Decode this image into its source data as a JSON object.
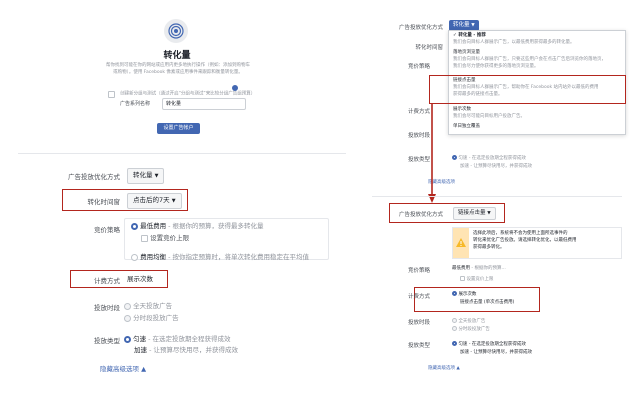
{
  "left": {
    "header": {
      "title": "转化量",
      "desc1": "帮你找到可能在你的网站或应用内更多地执行操作（例如：添加到购物车",
      "desc2": "或购物）。使用 Facebook 像素或应用事件来跟踪和衡量转化量。",
      "checkbox_label": "创建新分组与测试（通过开启“分组与测试”来比较分组广告组预算）",
      "campaign_name_label": "广告系列名称",
      "campaign_name_value": "转化量",
      "set_account_button": "设置广告帐户"
    },
    "optimization": {
      "label": "广告投放优化方式",
      "value": "转化量"
    },
    "window": {
      "label": "转化时间窗",
      "value": "点击后的7天"
    },
    "bid": {
      "label": "竞价策略",
      "option1_title": "最低费用",
      "option1_desc": " - 根据你的预算，获得最多转化量",
      "cap_label": "设置竞价上限",
      "option2_title": "费用均衡",
      "option2_desc": " - 按你指定预算时，将单次转化费用稳定在平均值"
    },
    "billing": {
      "label": "计费方式",
      "value": "展示次数"
    },
    "schedule": {
      "label": "投放时段",
      "option1": "全天投放广告",
      "option2": "分时段投放广告"
    },
    "delivery": {
      "label": "投放类型",
      "option1_title": "匀速",
      "option1_desc": " - 在选定投放期全程获得成效",
      "option2_title": "加速",
      "option2_desc": " - 让预算尽快用尽，并获得成效"
    },
    "hide_link": "隐藏高级选项 ▲"
  },
  "right": {
    "top": {
      "opt_label": "广告投放优化方式",
      "opt_value": "转化量",
      "window_label": "转化时间窗",
      "bid_label": "竞价策略",
      "billing_label": "计费方式",
      "schedule_label": "投放时段",
      "delivery_label": "投放类型",
      "delivery_desc": "匀速 - 在选定投放期全程获得成效",
      "delivery_desc2": "加速 - 让预算尽快用尽，并获得成效",
      "hide_link": "隐藏高级选项"
    },
    "menu": {
      "item1": "✓ 转化量 - 推荐",
      "item1_desc1": "我们会向目标人群展示广告，以最低费用获得最多的转化量。",
      "item2": "落地页浏览量",
      "item2_desc1": "我们会向目标人群展示广告，只要这些用户会在点击广告后浏览你的落地页，",
      "item2_desc2": "我们会尽力使你获得更多的落地页浏览量。",
      "item3": "链接点击量",
      "item3_desc1": "我们会向目标人群展示广告，帮助你在 Facebook 站内站外以最低的费用",
      "item3_desc2": "获得最多的链接点击量。",
      "item4": "展示次数",
      "item4_desc1": "我们会尽可能向目标用户投放广告。",
      "item5": "单日独立覆盖"
    },
    "bottom": {
      "opt_label": "广告投放优化方式",
      "opt_value": "链接点击量",
      "warn1": "选择此项后，系统将不会为使用上面所选事件的",
      "warn2": "转化来优化广告投放。请选择转化优化，以最低费用",
      "warn3": "获得最多转化。",
      "bid_label": "竞价策略",
      "bid_value": "最低费用",
      "bid_desc": " - 根据你的预算...",
      "cap_label": "设置竞价上限",
      "billing_label": "计费方式",
      "billing_opt1": "展示次数",
      "billing_opt2": "链接点击量 (单次点击费用)",
      "schedule_label": "投放时段",
      "schedule_opt1": "全天投放广告",
      "schedule_opt2": "分时段投放广告",
      "delivery_label": "投放类型",
      "delivery_opt1": "匀速 - 在选定投放期全程获得成效",
      "delivery_opt2": "加速 - 让预算尽快用尽，并获得成效",
      "hide_link": "隐藏高级选项 ▲"
    }
  }
}
